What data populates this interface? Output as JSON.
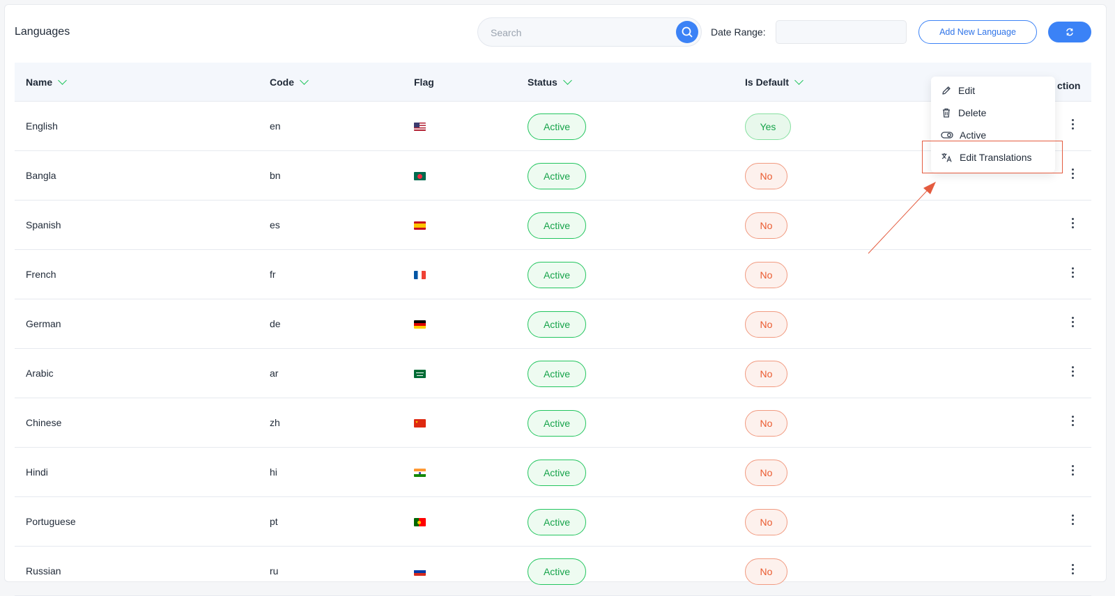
{
  "header": {
    "title": "Languages",
    "search_placeholder": "Search",
    "date_range_label": "Date Range:",
    "add_button": "Add New Language"
  },
  "table": {
    "columns": [
      "Name",
      "Code",
      "Flag",
      "Status",
      "Is Default",
      "Action"
    ],
    "action_partial": "ction",
    "rows": [
      {
        "name": "English",
        "code": "en",
        "flag": "us",
        "status": "Active",
        "default": "Yes"
      },
      {
        "name": "Bangla",
        "code": "bn",
        "flag": "bd",
        "status": "Active",
        "default": "No"
      },
      {
        "name": "Spanish",
        "code": "es",
        "flag": "es",
        "status": "Active",
        "default": "No"
      },
      {
        "name": "French",
        "code": "fr",
        "flag": "fr",
        "status": "Active",
        "default": "No"
      },
      {
        "name": "German",
        "code": "de",
        "flag": "de",
        "status": "Active",
        "default": "No"
      },
      {
        "name": "Arabic",
        "code": "ar",
        "flag": "sa",
        "status": "Active",
        "default": "No"
      },
      {
        "name": "Chinese",
        "code": "zh",
        "flag": "cn",
        "status": "Active",
        "default": "No"
      },
      {
        "name": "Hindi",
        "code": "hi",
        "flag": "in",
        "status": "Active",
        "default": "No"
      },
      {
        "name": "Portuguese",
        "code": "pt",
        "flag": "pt",
        "status": "Active",
        "default": "No"
      },
      {
        "name": "Russian",
        "code": "ru",
        "flag": "ru",
        "status": "Active",
        "default": "No"
      }
    ]
  },
  "menu": {
    "items": [
      {
        "label": "Edit",
        "icon": "pencil-icon"
      },
      {
        "label": "Delete",
        "icon": "trash-icon"
      },
      {
        "label": "Active",
        "icon": "toggle-icon"
      },
      {
        "label": "Edit Translations",
        "icon": "translate-icon"
      }
    ]
  },
  "colors": {
    "primary": "#3b82f6",
    "success": "#22c55e",
    "danger": "#ea5a2f",
    "annotation": "#e45b3f"
  }
}
